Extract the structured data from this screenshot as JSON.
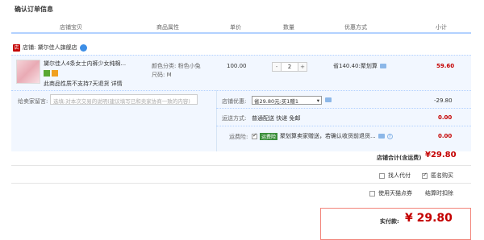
{
  "page": {
    "title": "确认订单信息"
  },
  "table_header": {
    "cols": [
      "店铺宝贝",
      "商品属性",
      "单价",
      "数量",
      "优惠方式",
      "小计"
    ]
  },
  "shop": {
    "label": "店铺: 黛尔佳人旗舰店"
  },
  "item": {
    "title": "黛尔佳人4条女士内裤少女纯棉...",
    "note": "此商品性质不支持7天退货 详情",
    "attr_color": "颜色分类: 粉色小兔",
    "attr_size": "尺码: M",
    "price": "100.00",
    "quantity": "2",
    "minus": "-",
    "plus": "+",
    "discount": "省140.40:聚划算",
    "subtotal": "59.60"
  },
  "order": {
    "message_label": "给卖家留言:",
    "message_placeholder": "选填:对本次交易的说明(建议填写已和卖家协商一致的内容)",
    "shop_discount_label": "店铺优惠:",
    "shop_discount_select": "省29.80元:买1赠1",
    "shop_discount_value": "-29.80",
    "shipping_label": "运送方式:",
    "shipping_value": "普通配送 快递 免邮",
    "shipping_price": "0.00",
    "insurance_label": "运费险:",
    "insurance_badge": "运费险",
    "insurance_text": "聚划算卖家赠送，若确认收货前退货...",
    "insurance_price": "0.00",
    "shop_total_label": "店铺合计(含运费)",
    "shop_total_value": "¥29.80"
  },
  "options": {
    "proxy_pay": "找人代付",
    "anonymous": "匿名购买",
    "use_points": "使用天猫点券",
    "points_note": "结算时扣除"
  },
  "final": {
    "label": "实付款:",
    "value": "¥ 29.80"
  },
  "colors": {
    "accent_red": "#c40000",
    "header_line": "#b2d1ff",
    "row_bg": "#f2f7ff"
  }
}
